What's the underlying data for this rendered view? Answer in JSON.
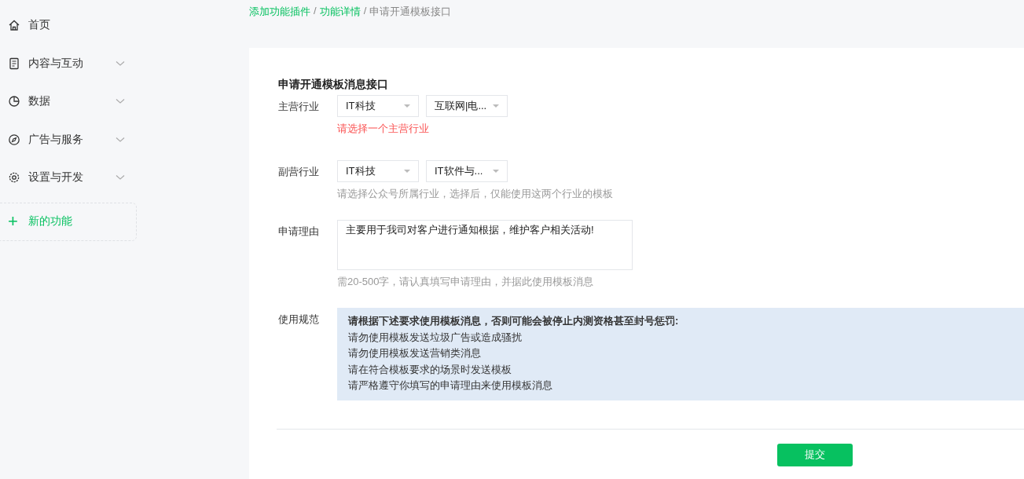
{
  "sidebar": {
    "items": [
      {
        "label": "首页",
        "expandable": false
      },
      {
        "label": "内容与互动",
        "expandable": true
      },
      {
        "label": "数据",
        "expandable": true
      },
      {
        "label": "广告与服务",
        "expandable": true
      },
      {
        "label": "设置与开发",
        "expandable": true
      }
    ],
    "new_feature": {
      "icon": "+",
      "label": "新的功能"
    }
  },
  "breadcrumb": {
    "links": [
      "添加功能插件",
      "功能详情"
    ],
    "separator": "/",
    "current": "申请开通模板接口"
  },
  "form": {
    "title": "申请开通模板消息接口",
    "primary_industry": {
      "label": "主营行业",
      "selects": [
        "IT科技",
        "互联网|电..."
      ],
      "error": "请选择一个主营行业"
    },
    "secondary_industry": {
      "label": "副营行业",
      "selects": [
        "IT科技",
        "IT软件与..."
      ],
      "hint": "请选择公众号所属行业，选择后，仅能使用这两个行业的模板"
    },
    "reason": {
      "label": "申请理由",
      "value": "主要用于我司对客户进行通知根据，维护客户相关活动!",
      "hint": "需20-500字，请认真填写申请理由，并据此使用模板消息"
    },
    "rules": {
      "label": "使用规范",
      "heading": "请根据下述要求使用模板消息，否则可能会被停止内测资格甚至封号惩罚:",
      "items": [
        "请勿使用模板发送垃圾广告或造成骚扰",
        "请勿使用模板发送营销类消息",
        "请在符合模板要求的场景时发送模板",
        "请严格遵守你填写的申请理由来使用模板消息"
      ]
    },
    "submit": "提交"
  }
}
